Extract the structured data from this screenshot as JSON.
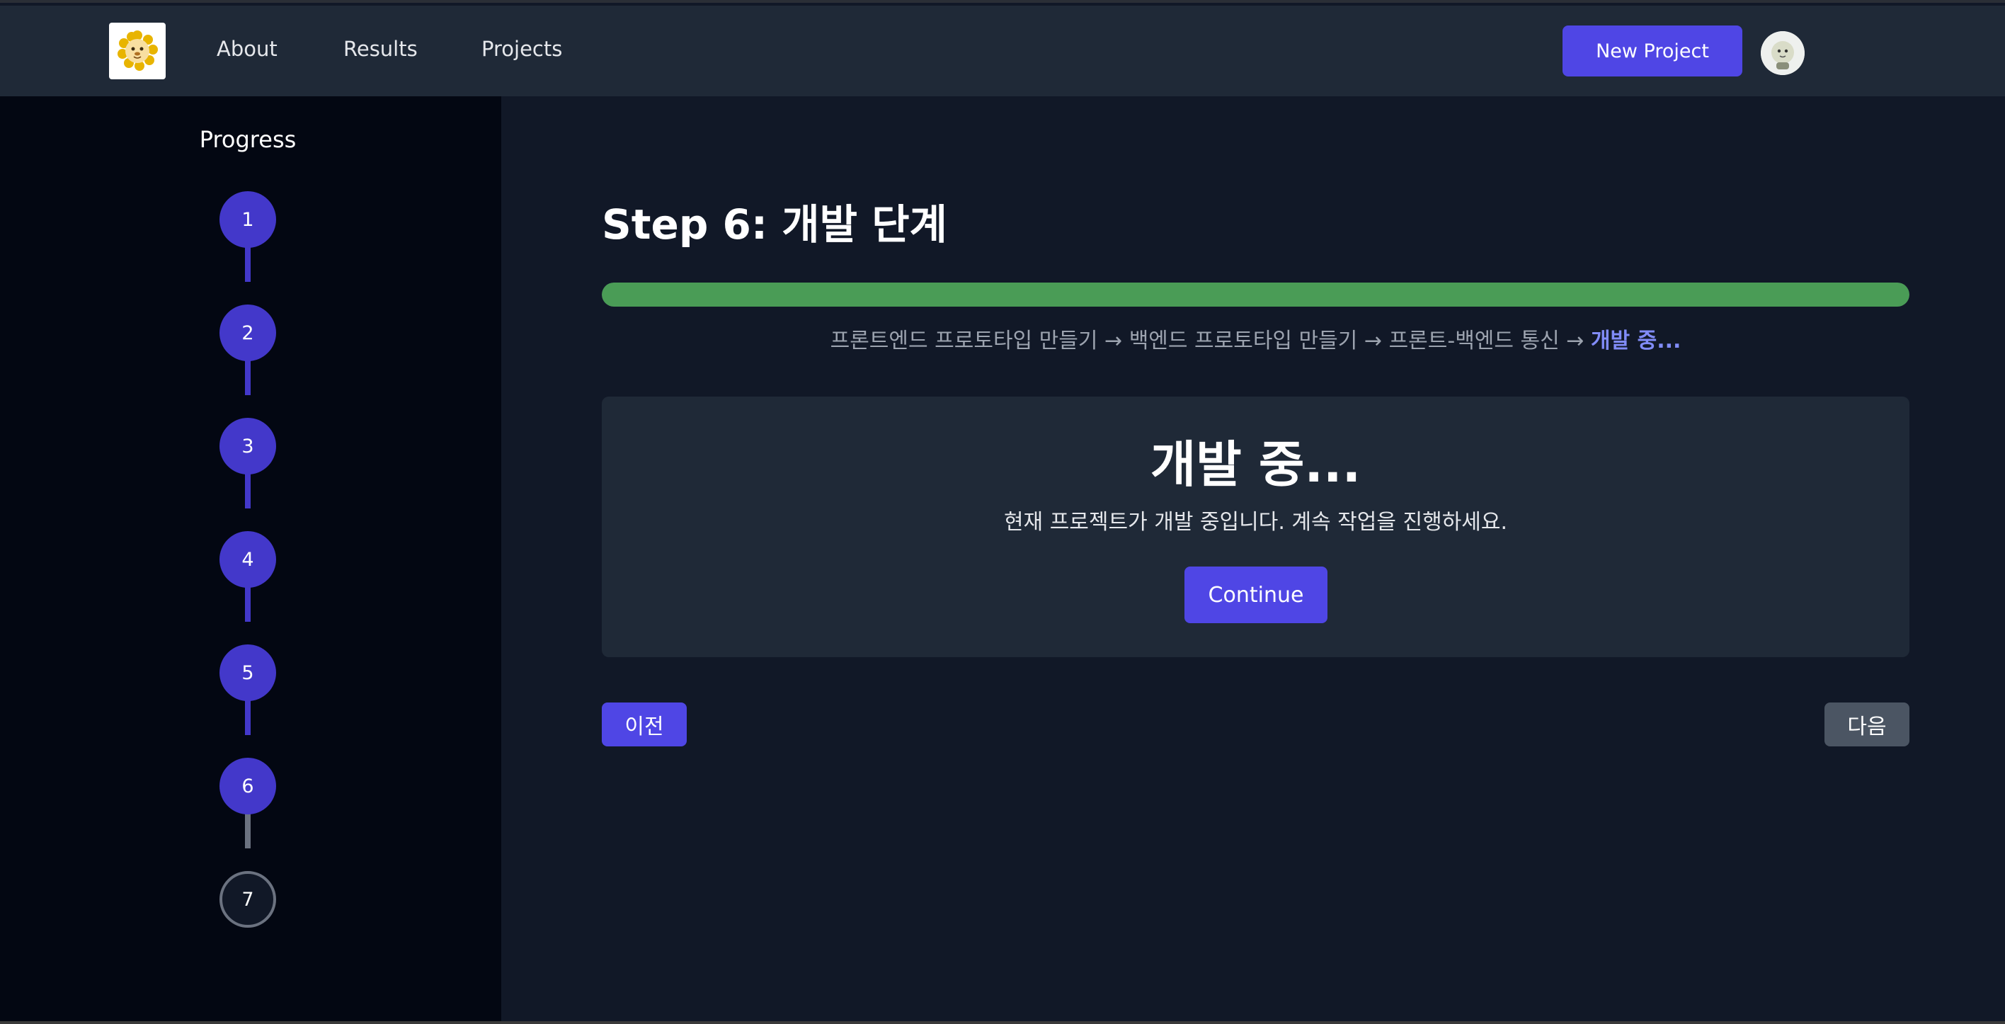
{
  "header": {
    "logo_icon": "lion-logo-icon",
    "nav": [
      "About",
      "Results",
      "Projects"
    ],
    "new_project_label": "New Project",
    "avatar_icon": "user-avatar-icon"
  },
  "sidebar": {
    "title": "Progress",
    "steps": [
      {
        "label": "1",
        "state": "done"
      },
      {
        "label": "2",
        "state": "done"
      },
      {
        "label": "3",
        "state": "done"
      },
      {
        "label": "4",
        "state": "done"
      },
      {
        "label": "5",
        "state": "done"
      },
      {
        "label": "6",
        "state": "current"
      },
      {
        "label": "7",
        "state": "pending"
      }
    ]
  },
  "main": {
    "title": "Step 6: 개발 단계",
    "progress_fraction": 1.0,
    "breadcrumb": {
      "text": "프론트엔드 프로토타입 만들기 → 백엔드 프로토타입 만들기 → 프론트-백엔드 통신 → ",
      "current": "개발 중..."
    },
    "card": {
      "title": "개발 중...",
      "description": "현재 프로젝트가 개발 중입니다. 계속 작업을 진행하세요.",
      "continue_label": "Continue"
    },
    "prev_label": "이전",
    "next_label": "다음"
  },
  "colors": {
    "accent": "#4f46e5",
    "progress_fill": "#4a9c56",
    "breadcrumb_current": "#818cf8",
    "header_bg": "#1f2937",
    "sidebar_bg": "#030712",
    "main_bg": "#111827"
  }
}
